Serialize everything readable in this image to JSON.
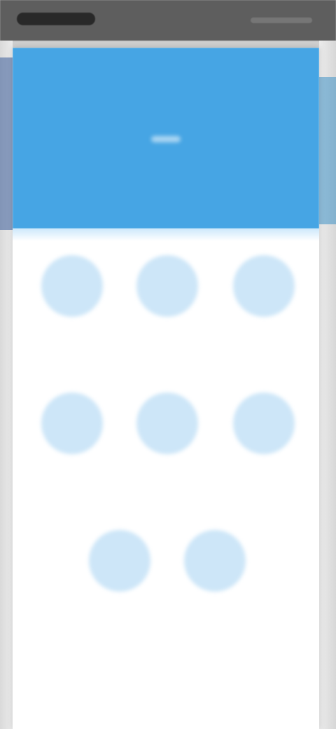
{
  "status_bar": {
    "time_text": "",
    "indicators_text": ""
  },
  "header": {
    "title": ""
  },
  "menu": {
    "items": [
      {
        "label": "",
        "icon": "circle-placeholder-icon"
      },
      {
        "label": "",
        "icon": "circle-placeholder-icon"
      },
      {
        "label": "",
        "icon": "circle-placeholder-icon"
      },
      {
        "label": "",
        "icon": "circle-placeholder-icon"
      },
      {
        "label": "",
        "icon": "circle-placeholder-icon"
      },
      {
        "label": "",
        "icon": "circle-placeholder-icon"
      },
      {
        "label": "",
        "icon": "circle-placeholder-icon"
      },
      {
        "label": "",
        "icon": "circle-placeholder-icon"
      }
    ]
  },
  "colors": {
    "header_blue": "#46a5e4",
    "tile_blue": "#cde6f8",
    "background_white": "#ffffff",
    "status_bar_gray": "#5e5e5e"
  }
}
